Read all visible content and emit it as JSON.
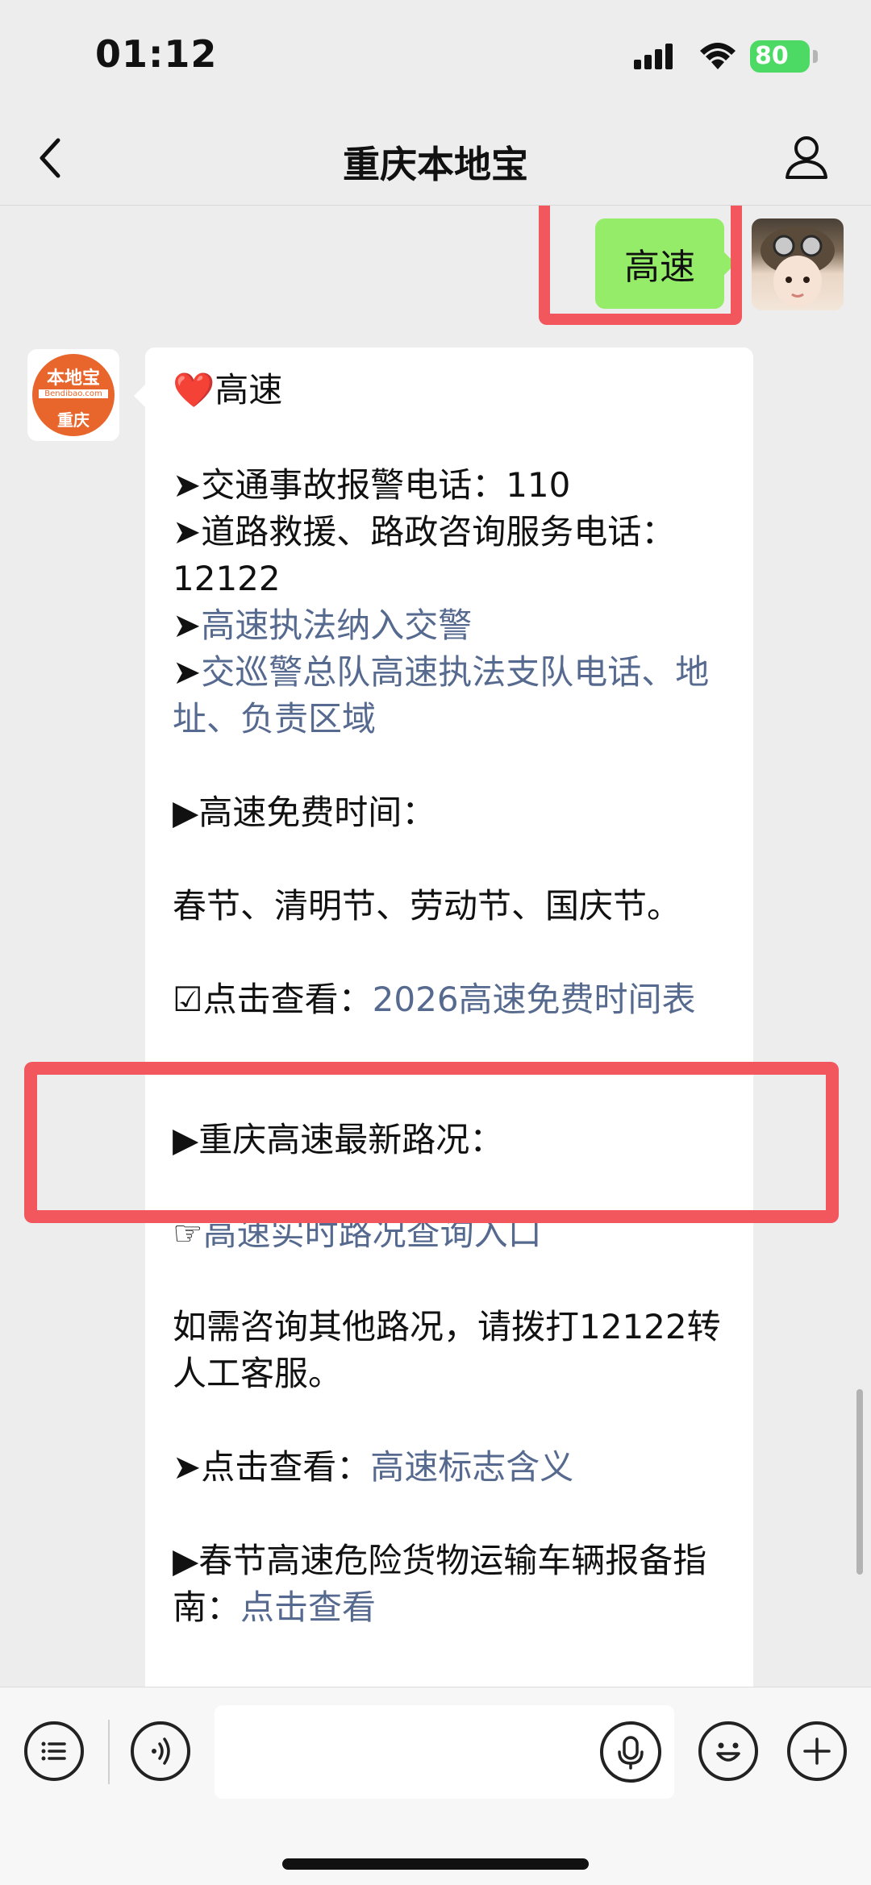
{
  "status_bar": {
    "time": "01:12",
    "battery": "80"
  },
  "nav": {
    "title": "重庆本地宝"
  },
  "messages": {
    "user": {
      "text": "高速"
    },
    "bot": {
      "logo_top": "本地宝",
      "logo_mid": "Bendibao.com",
      "logo_bottom": "重庆",
      "heart": "❤️",
      "title": "高速",
      "line_police": "➤交通事故报警电话：110",
      "line_rescue": "➤道路救援、路政咨询服务电话：12122",
      "line_enforcement_prefix": "➤",
      "link_enforcement": "高速执法纳入交警",
      "line_patrol_prefix": "➤",
      "link_patrol": "交巡警总队高速执法支队电话、地址、负责区域",
      "free_time_heading": "▶高速免费时间：",
      "free_time_holidays": "春节、清明节、劳动节、国庆节。",
      "free_time_check_prefix": "☑点击查看：",
      "link_free_time": "2026高速免费时间表",
      "road_heading": "▶重庆高速最新路况：",
      "road_link_prefix": "☞",
      "link_road": "高速实时路况查询入口",
      "consult": "如需咨询其他路况，请拨打12122转人工客服。",
      "signs_prefix": "➤点击查看：",
      "link_signs": "高速标志含义",
      "hazard_text": "▶春节高速危险货物运输车辆报备指南：",
      "link_hazard": "点击查看"
    }
  },
  "colors": {
    "accent_green": "#95ec69",
    "link": "#56698f",
    "highlight": "#f2575d"
  },
  "icons": [
    "back-icon",
    "profile-icon",
    "signal-icon",
    "wifi-icon",
    "battery-icon",
    "menu-icon",
    "voice-icon",
    "mic-icon",
    "emoji-icon",
    "plus-icon"
  ]
}
